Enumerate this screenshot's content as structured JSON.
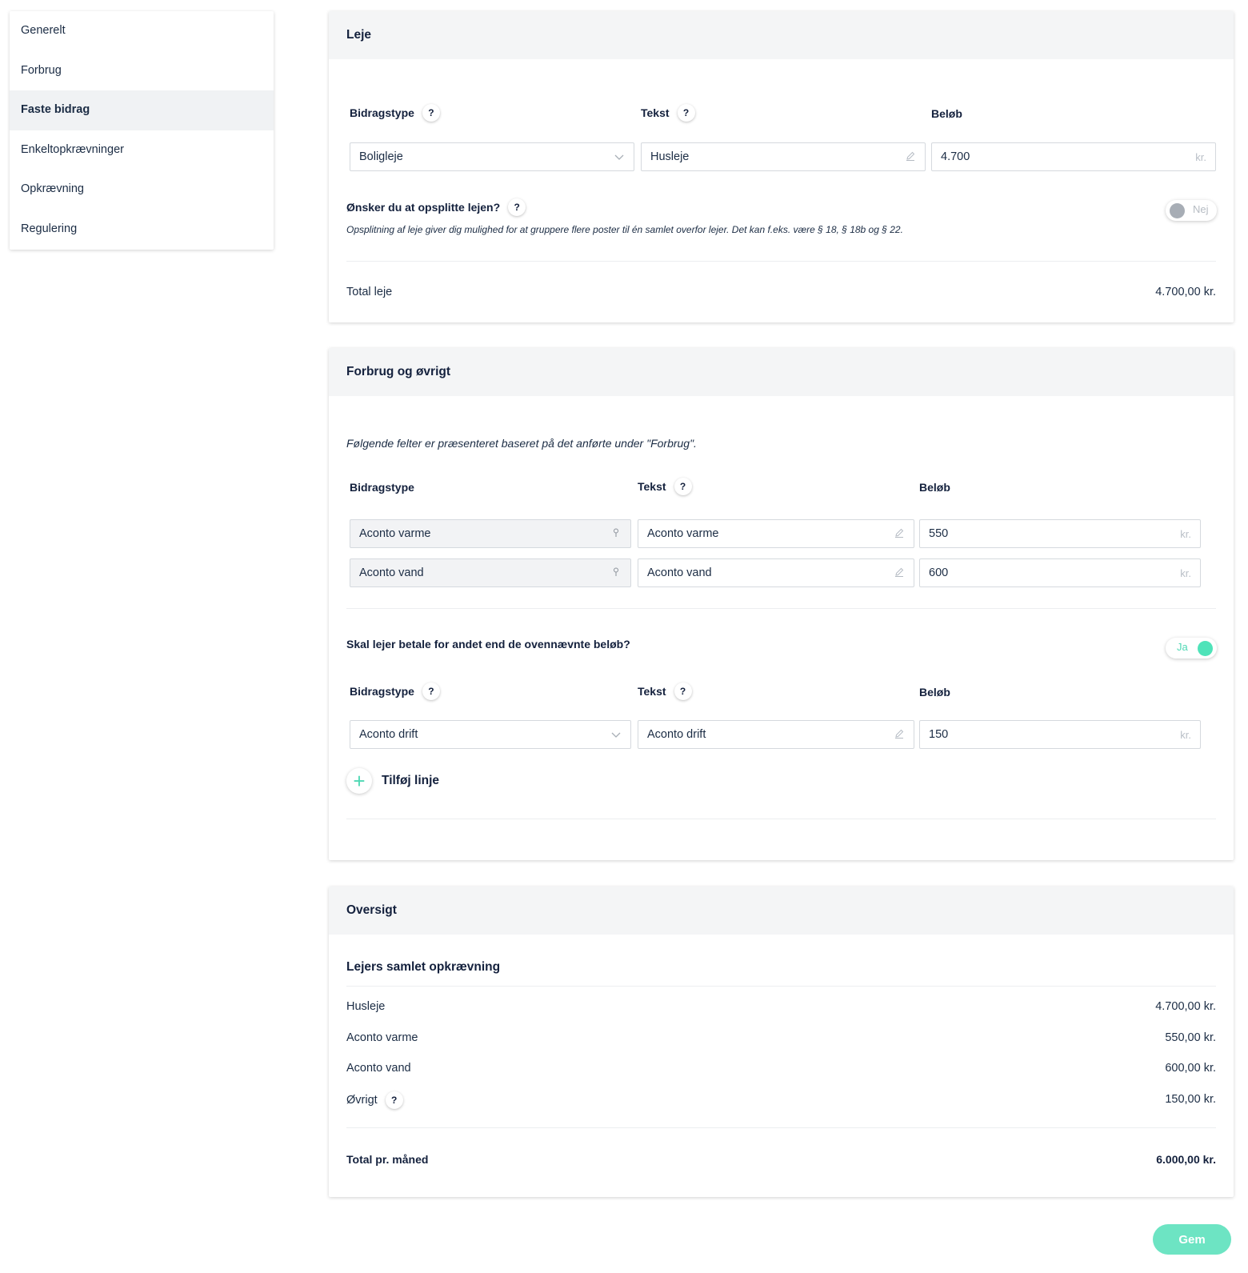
{
  "sidebar": {
    "items": [
      {
        "label": "Generelt"
      },
      {
        "label": "Forbrug"
      },
      {
        "label": "Faste bidrag"
      },
      {
        "label": "Enkeltopkrævninger"
      },
      {
        "label": "Opkrævning"
      },
      {
        "label": "Regulering"
      }
    ],
    "active_index": 2
  },
  "leje": {
    "title": "Leje",
    "col_bidragstype": "Bidragstype",
    "col_tekst": "Tekst",
    "col_belob": "Beløb",
    "help": "?",
    "row": {
      "bidragstype": "Boligleje",
      "tekst": "Husleje",
      "belob": "4.700",
      "suffix": "kr."
    },
    "split_question": "Ønsker du at opsplitte lejen?",
    "split_desc": "Opsplitning af leje giver dig mulighed for at gruppere flere poster til én samlet overfor lejer. Det kan f.eks. være § 18, § 18b og § 22.",
    "split_toggle": "Nej",
    "total_label": "Total leje",
    "total_value": "4.700,00 kr."
  },
  "forbrug": {
    "title": "Forbrug og øvrigt",
    "intro": "Følgende felter er præsenteret baseret på det anførte under \"Forbrug\".",
    "col_bidragstype": "Bidragstype",
    "col_tekst": "Tekst",
    "col_belob": "Beløb",
    "help": "?",
    "rows": [
      {
        "bidragstype": "Aconto varme",
        "tekst": "Aconto varme",
        "belob": "550",
        "suffix": "kr."
      },
      {
        "bidragstype": "Aconto vand",
        "tekst": "Aconto vand",
        "belob": "600",
        "suffix": "kr."
      }
    ],
    "other_question": "Skal lejer betale for andet end de ovennævnte beløb?",
    "other_toggle": "Ja",
    "other_row": {
      "bidragstype": "Aconto drift",
      "tekst": "Aconto drift",
      "belob": "150",
      "suffix": "kr."
    },
    "add_line": "Tilføj linje",
    "add_symbol": "+"
  },
  "oversigt": {
    "title": "Oversigt",
    "subtitle": "Lejers samlet opkrævning",
    "help": "?",
    "lines": [
      {
        "label": "Husleje",
        "value": "4.700,00 kr."
      },
      {
        "label": "Aconto varme",
        "value": "550,00 kr."
      },
      {
        "label": "Aconto vand",
        "value": "600,00 kr."
      },
      {
        "label": "Øvrigt",
        "value": "150,00 kr."
      }
    ],
    "total_label": "Total pr. måned",
    "total_value": "6.000,00 kr."
  },
  "save_label": "Gem",
  "icons": {
    "dropdown": "chevron-down-icon",
    "edit": "pencil-icon",
    "lock": "lock-icon",
    "help": "help-icon",
    "add": "plus-icon"
  },
  "colors": {
    "accent": "#4fd8b4",
    "save_button": "#6de4c3",
    "toggle_off_knob": "#a7adb5"
  }
}
